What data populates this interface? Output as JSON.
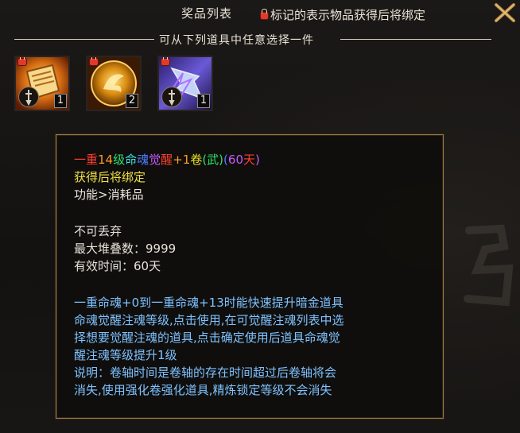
{
  "window": {
    "title": "奖品列表",
    "bind_note": "标记的表示物品获得后将绑定",
    "close_icon": "close-x-icon"
  },
  "section": {
    "heading": "可从下列道具中任意选择一件"
  },
  "items": [
    {
      "name": "scroll-orange",
      "count": "1",
      "icon": "scroll-icon",
      "locked": true
    },
    {
      "name": "phoenix-orb",
      "count": "2",
      "icon": "phoenix-icon",
      "locked": true
    },
    {
      "name": "lightning-scroll",
      "count": "1",
      "icon": "lightning-icon",
      "locked": true
    }
  ],
  "tooltip": {
    "title_parts": [
      {
        "text": "一重",
        "color": "#ff3d2e"
      },
      {
        "text": "14",
        "color": "#ff9a24"
      },
      {
        "text": "级",
        "color": "#2ee06a"
      },
      {
        "text": "命",
        "color": "#38e3e0"
      },
      {
        "text": "魂",
        "color": "#4f7dff"
      },
      {
        "text": "觉",
        "color": "#c65bff"
      },
      {
        "text": "醒",
        "color": "#ff3d2e"
      },
      {
        "text": "+1",
        "color": "#ff9a24"
      },
      {
        "text": "卷",
        "color": "#e8e22a"
      },
      {
        "text": "(武)",
        "color": "#2ee06a"
      },
      {
        "text": "(",
        "color": "#4f7dff"
      },
      {
        "text": "60",
        "color": "#c65bff"
      },
      {
        "text": "天",
        "color": "#ff3d2e"
      },
      {
        "text": ")",
        "color": "#c65bff"
      }
    ],
    "bind_status": "获得后将绑定",
    "function": "功能>消耗品",
    "discard": "不可丢弃",
    "stack": "最大堆叠数：9999",
    "duration": "有效时间：60天",
    "desc_lines": [
      "一重命魂+0到一重命魂+13时能快速提升暗金道具",
      "命魂觉醒注魂等级,点击使用,在可觉醒注魂列表中选",
      "择想要觉醒注魂的道具,点击确定使用后道具命魂觉",
      "醒注魂等级提升1级",
      "说明：卷轴时间是卷轴的存在时间超过后卷轴将会",
      "消失,使用强化卷强化道具,精炼锁定等级不会消失"
    ]
  }
}
